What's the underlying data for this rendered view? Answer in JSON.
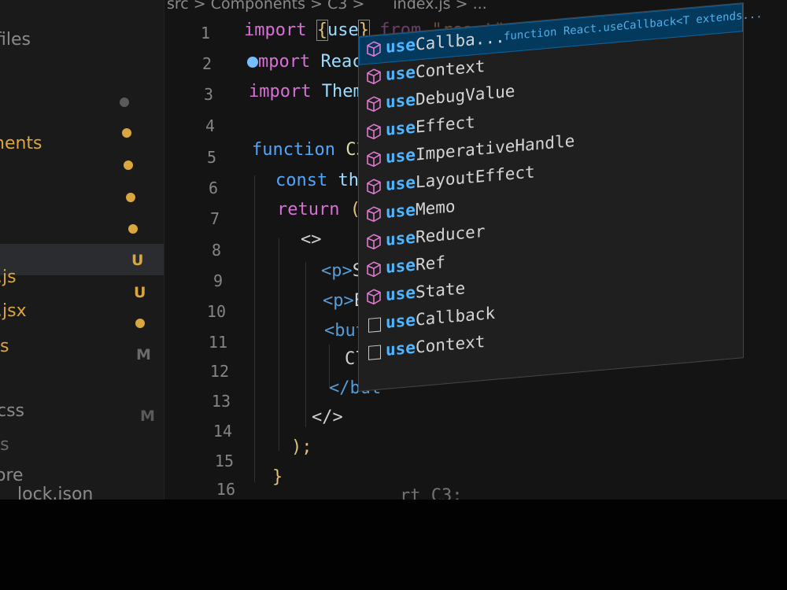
{
  "breadcrumb": {
    "parts": [
      "src",
      ">",
      "Components",
      ">",
      "C3",
      ">",
      "index.js",
      ">",
      "..."
    ]
  },
  "sidebar": {
    "items": [
      {
        "label": "files",
        "color": "#8a8a8a"
      },
      {
        "label": "nents",
        "color": "#d9a640"
      },
      {
        "label": ".js",
        "color": "#d9a640"
      },
      {
        "label": ".jsx",
        "color": "#d9a640"
      },
      {
        "label": "s",
        "color": "#d9a640"
      },
      {
        "label": "css",
        "color": "#8a8a8a"
      },
      {
        "label": "js",
        "color": "#7a7a7a"
      },
      {
        "label": "ore",
        "color": "#8a8a8a"
      },
      {
        "label": "lock.json",
        "color": "#8a8a8a"
      }
    ],
    "badges": [
      "U",
      "U",
      "M",
      "M"
    ]
  },
  "editor": {
    "line_numbers": [
      "1",
      "2",
      "3",
      "4",
      "5",
      "6",
      "7",
      "8",
      "9",
      "10",
      "11",
      "12",
      "13",
      "14",
      "15",
      "16"
    ],
    "lines": {
      "l1_import": "import",
      "l1_brace_open": "{",
      "l1_use": "use",
      "l1_brace_close": "}",
      "l1_from": "from",
      "l1_str": "\"react\"",
      "l2_import": "mport",
      "l2_rest": "Reac",
      "l3_import": "import",
      "l3_rest": "Them",
      "l5_function": "function",
      "l5_name": "C3",
      "l6_const": "const",
      "l6_rest": "the",
      "l7_return": "return",
      "l7_paren": "(",
      "l8_frag": "<>",
      "l9_tag": "<p>",
      "l9_text": "So",
      "l10_tag": "<p>",
      "l10_text": "En",
      "l11_tag": "<butt",
      "l12_text": "Cli",
      "l13_tag": "</but",
      "l14_frag": "</>",
      "l15_close": ");",
      "l16_close": "}",
      "l17_partial": "rt C3;"
    }
  },
  "suggest": {
    "detail": "function React.useCallback<T extends...",
    "items": [
      {
        "prefix": "use",
        "rest": "Callba...",
        "kind": "cube"
      },
      {
        "prefix": "use",
        "rest": "Context",
        "kind": "cube"
      },
      {
        "prefix": "use",
        "rest": "DebugValue",
        "kind": "cube"
      },
      {
        "prefix": "use",
        "rest": "Effect",
        "kind": "cube"
      },
      {
        "prefix": "use",
        "rest": "ImperativeHandle",
        "kind": "cube"
      },
      {
        "prefix": "use",
        "rest": "LayoutEffect",
        "kind": "cube"
      },
      {
        "prefix": "use",
        "rest": "Memo",
        "kind": "cube"
      },
      {
        "prefix": "use",
        "rest": "Reducer",
        "kind": "cube"
      },
      {
        "prefix": "use",
        "rest": "Ref",
        "kind": "cube"
      },
      {
        "prefix": "use",
        "rest": "State",
        "kind": "cube"
      },
      {
        "prefix": "use",
        "rest": "Callback",
        "kind": "square"
      },
      {
        "prefix": "use",
        "rest": "Context",
        "kind": "square"
      }
    ]
  },
  "ghost_text": [
    "useCallback",
    "useContext"
  ],
  "colors": {
    "accent": "#4fb6ff",
    "keyword": "#d670d6",
    "modified": "#d9a640"
  }
}
